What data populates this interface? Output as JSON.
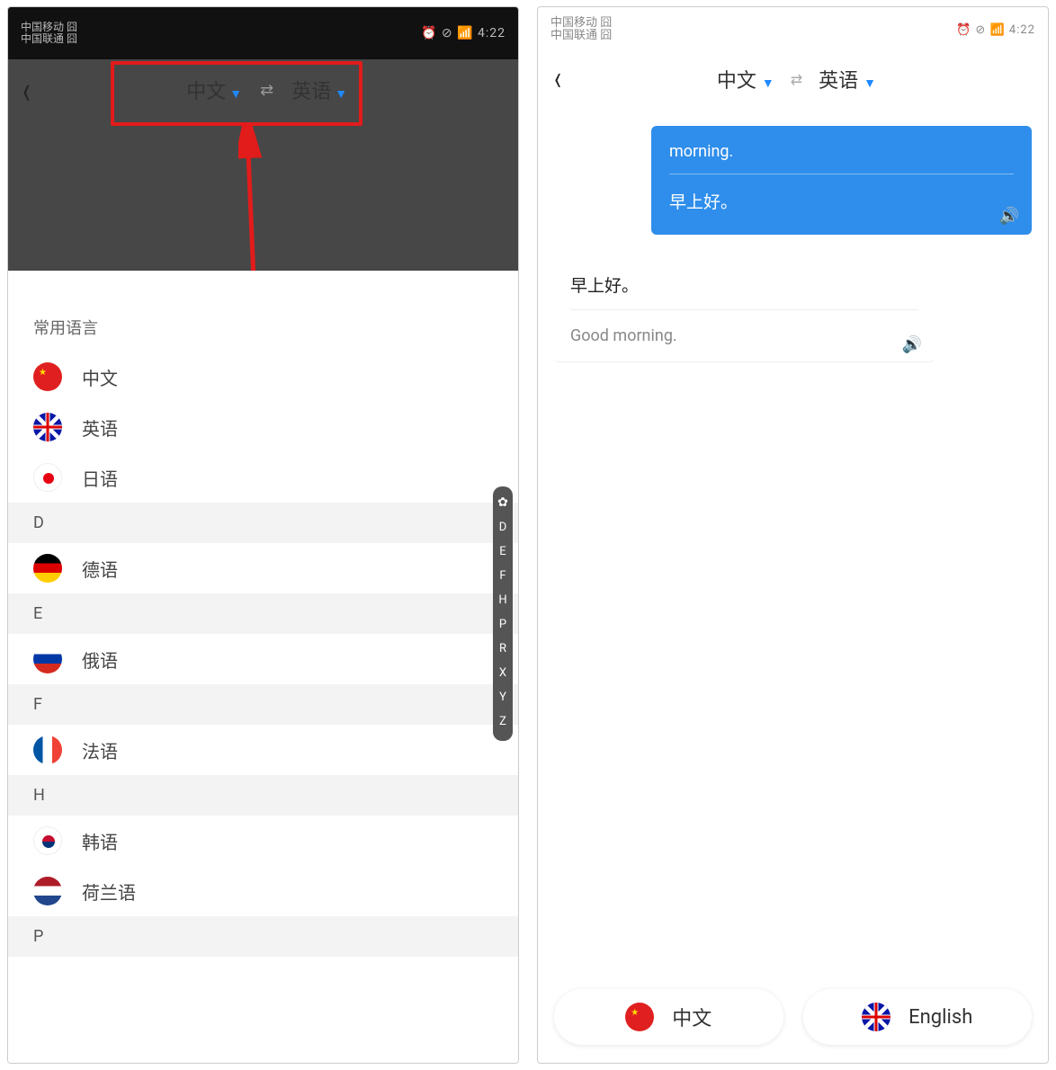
{
  "statusbar": {
    "time": "4:22",
    "carrier_top": "中国移动 囧",
    "carrier_bot": "中国联通 囧",
    "icons_right": "⏰ ⊘ 📶 4:22"
  },
  "left": {
    "header": {
      "source": "中文",
      "target": "英语"
    },
    "sheet_title": "常用语言",
    "common": [
      {
        "flag": "cn",
        "label": "中文"
      },
      {
        "flag": "uk",
        "label": "英语"
      },
      {
        "flag": "jp",
        "label": "日语"
      }
    ],
    "sections": [
      {
        "letter": "D",
        "items": [
          {
            "flag": "de",
            "label": "德语"
          }
        ]
      },
      {
        "letter": "E",
        "items": [
          {
            "flag": "ru",
            "label": "俄语"
          }
        ]
      },
      {
        "letter": "F",
        "items": [
          {
            "flag": "fr",
            "label": "法语"
          }
        ]
      },
      {
        "letter": "H",
        "items": [
          {
            "flag": "kr",
            "label": "韩语"
          },
          {
            "flag": "nl",
            "label": "荷兰语"
          }
        ]
      },
      {
        "letter": "P",
        "items": []
      }
    ],
    "index": [
      "✿",
      "D",
      "E",
      "F",
      "H",
      "P",
      "R",
      "X",
      "Y",
      "Z"
    ]
  },
  "right": {
    "header": {
      "source": "中文",
      "target": "英语"
    },
    "bubble1": {
      "src": "morning.",
      "tgt": "早上好。"
    },
    "bubble2": {
      "src": "早上好。",
      "tgt": "Good morning."
    },
    "bottom": {
      "left": "中文",
      "right": "English"
    }
  }
}
